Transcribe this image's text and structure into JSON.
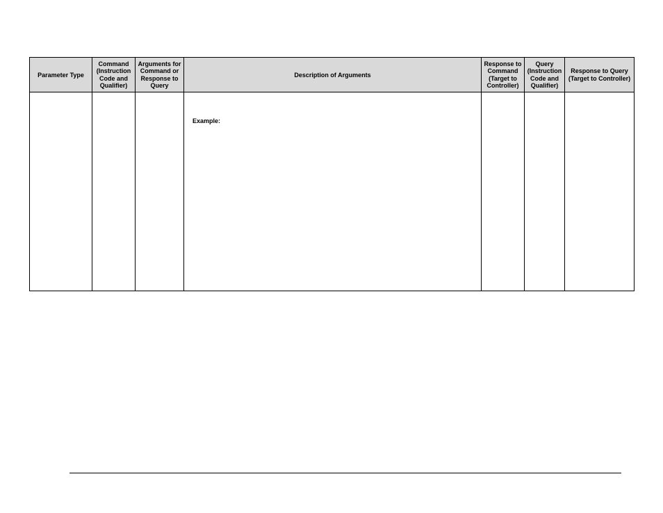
{
  "table": {
    "headers": {
      "parameter_type": "Parameter Type",
      "command": "Command (Instruction Code and Qualifier)",
      "arguments": "Arguments for Command or Response to Query",
      "description": "Description of Arguments",
      "response_cmd": "Response to Command (Target to Controller)",
      "query": "Query (Instruction Code and Qualifier)",
      "response_query": "Response to Query (Target to Controller)"
    },
    "row": {
      "parameter_type": "",
      "command": "",
      "arguments": "",
      "description": "Example:",
      "response_cmd": "",
      "query": "",
      "response_query": ""
    }
  }
}
